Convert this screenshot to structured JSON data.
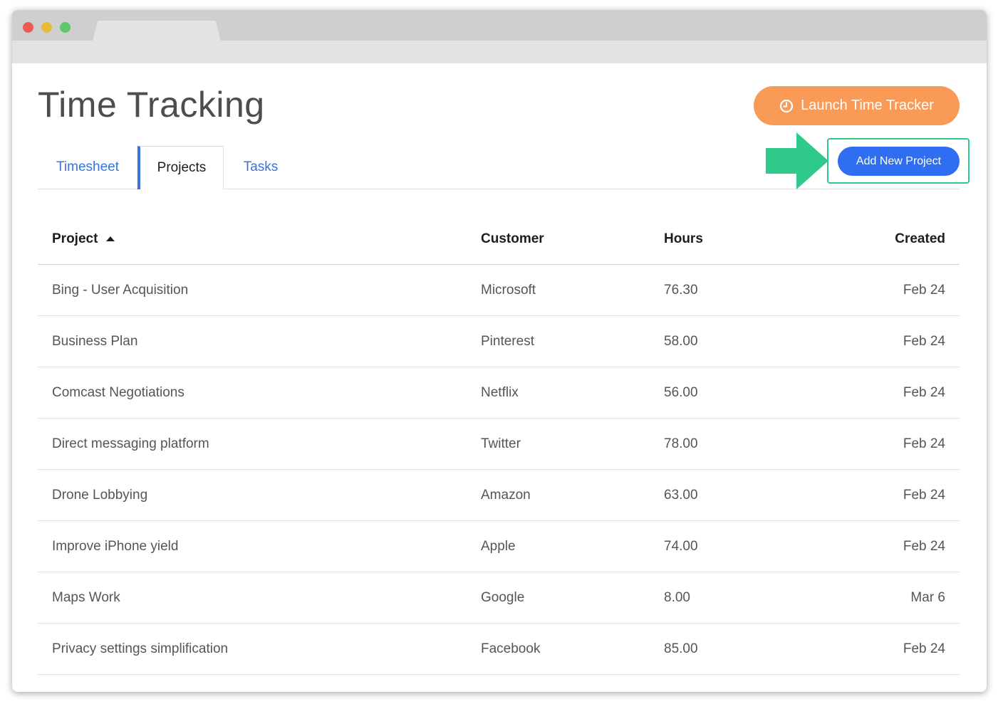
{
  "page": {
    "title": "Time Tracking"
  },
  "actions": {
    "launch_label": "Launch Time Tracker",
    "add_label": "Add New Project"
  },
  "tabs": [
    {
      "label": "Timesheet"
    },
    {
      "label": "Projects"
    },
    {
      "label": "Tasks"
    }
  ],
  "active_tab": "Projects",
  "table": {
    "columns": [
      "Project",
      "Customer",
      "Hours",
      "Created"
    ],
    "sort_column": "Project",
    "sort_direction": "ascending",
    "rows": [
      {
        "project": "Bing - User Acquisition",
        "customer": "Microsoft",
        "hours": "76.30",
        "created": "Feb 24"
      },
      {
        "project": "Business Plan",
        "customer": "Pinterest",
        "hours": "58.00",
        "created": "Feb 24"
      },
      {
        "project": "Comcast Negotiations",
        "customer": "Netflix",
        "hours": "56.00",
        "created": "Feb 24"
      },
      {
        "project": "Direct messaging platform",
        "customer": "Twitter",
        "hours": "78.00",
        "created": "Feb 24"
      },
      {
        "project": "Drone Lobbying",
        "customer": "Amazon",
        "hours": "63.00",
        "created": "Feb 24"
      },
      {
        "project": "Improve iPhone yield",
        "customer": "Apple",
        "hours": "74.00",
        "created": "Feb 24"
      },
      {
        "project": "Maps Work",
        "customer": "Google",
        "hours": "8.00",
        "created": "Mar 6"
      },
      {
        "project": "Privacy settings simplification",
        "customer": "Facebook",
        "hours": "85.00",
        "created": "Feb 24"
      }
    ]
  },
  "colors": {
    "launch_button": "#f99a57",
    "add_button": "#2f6ef0",
    "active_tab_accent": "#3b73d9",
    "highlight_arrow": "#2fc98c"
  },
  "icons": {
    "launch": "clock-icon",
    "sort": "sort-ascending-icon",
    "callout": "arrow-right-icon"
  }
}
